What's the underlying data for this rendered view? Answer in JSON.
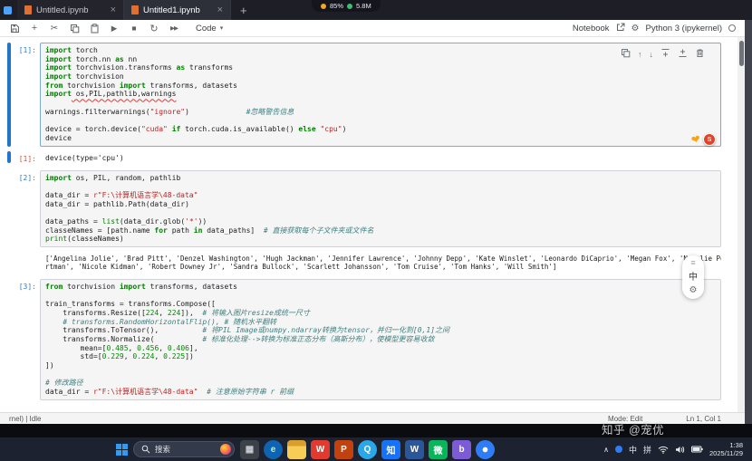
{
  "browser": {
    "tabs": [
      {
        "title": "Untitled.ipynb"
      },
      {
        "title": "Untitled1.ipynb"
      }
    ],
    "close_glyph": "×",
    "new_tab_glyph": "+",
    "overlay": {
      "left": "85%",
      "right": "5.8M"
    }
  },
  "toolbar": {
    "cell_type_label": "Code",
    "notebook_label": "Notebook",
    "kernel_label": "Python 3 (ipykernel)",
    "glyphs": {
      "add": "+",
      "cut": "✂",
      "run": "▶",
      "stop": "■",
      "restart": "↻",
      "run_all": "▶▶",
      "caret": "▾",
      "gear": "⚙"
    }
  },
  "cell_toolbar": {
    "up": "↑",
    "down": "↓"
  },
  "colors": {
    "accent": "#2176c7",
    "in_prompt": "#307fc1",
    "out_prompt": "#bf5b3d",
    "keyword": "#008000",
    "string": "#ba2121",
    "comment": "#408080",
    "number": "#008800"
  },
  "notebook": {
    "cells": [
      {
        "kind": "code",
        "prompt": "[1]:",
        "active": true,
        "tokens": [
          [
            [
              "k",
              "import"
            ],
            [
              "d",
              " torch"
            ]
          ],
          [
            [
              "k",
              "import"
            ],
            [
              "d",
              " torch.nn "
            ],
            [
              "k",
              "as"
            ],
            [
              "d",
              " nn"
            ]
          ],
          [
            [
              "k",
              "import"
            ],
            [
              "d",
              " torchvision.transforms "
            ],
            [
              "k",
              "as"
            ],
            [
              "d",
              " transforms"
            ]
          ],
          [
            [
              "k",
              "import"
            ],
            [
              "d",
              " torchvision"
            ]
          ],
          [
            [
              "k",
              "from"
            ],
            [
              "d",
              " torchvision "
            ],
            [
              "k",
              "import"
            ],
            [
              "d",
              " transforms, datasets"
            ]
          ],
          [
            [
              "k",
              "import"
            ],
            [
              "u",
              " os,PIL,pathlib,warnings"
            ]
          ],
          [],
          [
            [
              "d",
              "warnings.filterwarnings("
            ],
            [
              "s",
              "\"ignore\""
            ],
            [
              "d",
              ")             "
            ],
            [
              "c",
              "#忽略警告信息"
            ]
          ],
          [],
          [
            [
              "d",
              "device = torch.device("
            ],
            [
              "s",
              "\"cuda\""
            ],
            [
              "d",
              " "
            ],
            [
              "k",
              "if"
            ],
            [
              "d",
              " torch.cuda.is_available() "
            ],
            [
              "k",
              "else"
            ],
            [
              "d",
              " "
            ],
            [
              "s",
              "\"cpu\""
            ],
            [
              "d",
              ")"
            ]
          ],
          [
            [
              "d",
              "device"
            ]
          ]
        ]
      },
      {
        "kind": "out",
        "prompt": "[1]:",
        "active": true,
        "text": [
          "device(type='cpu')"
        ]
      },
      {
        "kind": "code",
        "prompt": "[2]:",
        "tokens": [
          [
            [
              "k",
              "import"
            ],
            [
              "d",
              " os, PIL, random, pathlib"
            ]
          ],
          [],
          [
            [
              "d",
              "data_dir = "
            ],
            [
              "s",
              "r\"F:\\计算机语言学\\48-data\""
            ]
          ],
          [
            [
              "d",
              "data_dir = pathlib.Path(data_dir)"
            ]
          ],
          [],
          [
            [
              "d",
              "data_paths = "
            ],
            [
              "b",
              "list"
            ],
            [
              "d",
              "(data_dir.glob("
            ],
            [
              "s",
              "'*'"
            ],
            [
              "d",
              "))"
            ]
          ],
          [
            [
              "d",
              "classeNames = [path.name "
            ],
            [
              "k",
              "for"
            ],
            [
              "d",
              " path "
            ],
            [
              "k",
              "in"
            ],
            [
              "d",
              " data_paths]  "
            ],
            [
              "c",
              "# 直接获取每个子文件夹或文件名"
            ]
          ],
          [
            [
              "b",
              "print"
            ],
            [
              "d",
              "(classeNames)"
            ]
          ]
        ]
      },
      {
        "kind": "out",
        "prompt": "",
        "small": true,
        "text": [
          "['Angelina Jolie', 'Brad Pitt', 'Denzel Washington', 'Hugh Jackman', 'Jennifer Lawrence', 'Johnny Depp', 'Kate Winslet', 'Leonardo DiCaprio', 'Megan Fox', 'Natalie Po",
          "rtman', 'Nicole Kidman', 'Robert Downey Jr', 'Sandra Bullock', 'Scarlett Johansson', 'Tom Cruise', 'Tom Hanks', 'Will Smith']"
        ]
      },
      {
        "kind": "code",
        "prompt": "[3]:",
        "tokens": [
          [
            [
              "k",
              "from"
            ],
            [
              "d",
              " torchvision "
            ],
            [
              "k",
              "import"
            ],
            [
              "d",
              " transforms, datasets"
            ]
          ],
          [],
          [
            [
              "d",
              "train_transforms = transforms.Compose(["
            ]
          ],
          [
            [
              "d",
              "    transforms.Resize(["
            ],
            [
              "n",
              "224"
            ],
            [
              "d",
              ", "
            ],
            [
              "n",
              "224"
            ],
            [
              "d",
              "]),  "
            ],
            [
              "c",
              "# 将输入图片resize成统一尺寸"
            ]
          ],
          [
            [
              "c",
              "    # transforms.RandomHorizontalFlip(), # 随机水平翻转"
            ]
          ],
          [
            [
              "d",
              "    transforms.ToTensor(),          "
            ],
            [
              "c",
              "# 将PIL Image或numpy.ndarray转换为tensor，并归一化到[0,1]之间"
            ]
          ],
          [
            [
              "d",
              "    transforms.Normalize(           "
            ],
            [
              "c",
              "# 标准化处理-->转换为标准正态分布（高斯分布），使模型更容易收敛"
            ]
          ],
          [
            [
              "d",
              "        mean=["
            ],
            [
              "n",
              "0.485"
            ],
            [
              "d",
              ", "
            ],
            [
              "n",
              "0.456"
            ],
            [
              "d",
              ", "
            ],
            [
              "n",
              "0.406"
            ],
            [
              "d",
              "],"
            ]
          ],
          [
            [
              "d",
              "        std=["
            ],
            [
              "n",
              "0.229"
            ],
            [
              "d",
              ", "
            ],
            [
              "n",
              "0.224"
            ],
            [
              "d",
              ", "
            ],
            [
              "n",
              "0.225"
            ],
            [
              "d",
              "])"
            ]
          ],
          [
            [
              "d",
              "])"
            ]
          ],
          [],
          [
            [
              "c",
              "# 修改路径"
            ]
          ],
          [
            [
              "d",
              "data_dir = "
            ],
            [
              "s",
              "r\"F:\\计算机语言学\\48-data\""
            ],
            [
              "d",
              "  "
            ],
            [
              "c",
              "# 注意原始字符串 r 前缀"
            ]
          ]
        ]
      }
    ]
  },
  "reactions": {
    "heart": "❤",
    "badge": "S"
  },
  "float_widget": {
    "handle": "≡",
    "translate": "中",
    "gear": "⚙"
  },
  "status_bar": {
    "left": "rnel) | Idle",
    "mode": "Mode: Edit",
    "position": "Ln 1, Col 1"
  },
  "watermark": {
    "text": "知乎 @宠优"
  },
  "taskbar": {
    "search_label": "搜索",
    "apps": [
      {
        "name": "app-icon-dark-grid",
        "glyph": "▦",
        "bg": "#3d4148",
        "fg": "#c9ced6"
      },
      {
        "name": "app-edge-browser",
        "glyph": "e",
        "bg": "#0e63b3",
        "fg": "#aef0dc",
        "shape": "circle"
      },
      {
        "name": "app-file-explorer-folder",
        "glyph": "",
        "bg": "linear-gradient(180deg,#d99e2b 0%,#d99e2b 32%,#f7ce55 32%)",
        "fg": "#fff"
      },
      {
        "name": "app-wps-red",
        "glyph": "W",
        "bg": "#e23a2e",
        "fg": "#fff"
      },
      {
        "name": "app-orange-p",
        "glyph": "P",
        "bg": "#c2410f",
        "fg": "#fff"
      },
      {
        "name": "app-qq-blue",
        "glyph": "Q",
        "bg": "#28a8ea",
        "fg": "#fff",
        "shape": "circle"
      },
      {
        "name": "app-zhihu-blue",
        "glyph": "知",
        "bg": "#1772f6",
        "fg": "#fff"
      },
      {
        "name": "app-word-blue",
        "glyph": "W",
        "bg": "#2b579a",
        "fg": "#fff"
      },
      {
        "name": "app-wechat-green",
        "glyph": "微",
        "bg": "#07b65b",
        "fg": "#fff"
      },
      {
        "name": "app-purple-b",
        "glyph": "b",
        "bg": "#7b5cd6",
        "fg": "#fff"
      },
      {
        "name": "app-blue-circle",
        "glyph": "",
        "bg": "radial-gradient(circle at 50% 50%,#fff 0 18%,#2f7df6 20%)",
        "fg": "#fff",
        "shape": "circle"
      }
    ],
    "tray": {
      "chevron": "∧",
      "ime": "中",
      "ime2": "拼",
      "time": "1:38",
      "date": "2025/11/29"
    }
  }
}
